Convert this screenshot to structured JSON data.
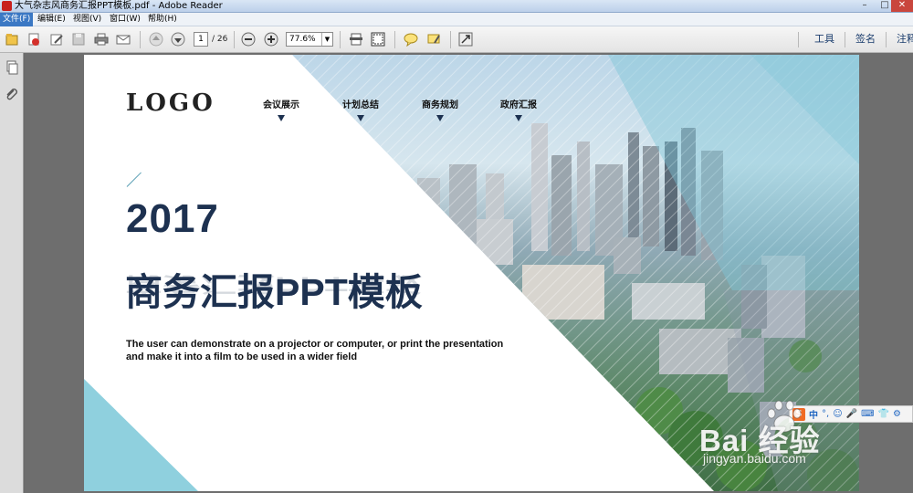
{
  "window": {
    "title": "大气杂志风商务汇报PPT模板.pdf - Adobe Reader",
    "min_label": "–",
    "max_label": "□",
    "close_label": "✕"
  },
  "menu": {
    "items": [
      {
        "label": "文件(F)",
        "active": true
      },
      {
        "label": "编辑(E)"
      },
      {
        "label": "视图(V)"
      },
      {
        "label": "窗口(W)"
      },
      {
        "label": "帮助(H)"
      }
    ]
  },
  "toolbar": {
    "page_current": "1",
    "page_total": "/ 26",
    "zoom": "77.6%",
    "right_links": [
      "工具",
      "签名",
      "注释"
    ]
  },
  "slide": {
    "logo": "LOGO",
    "nav": [
      "会议展示",
      "计划总结",
      "商务规划",
      "政府汇报"
    ],
    "year": "2017",
    "headline": "商务汇报PPT模板",
    "subtext_line1": "The user can demonstrate on a projector or computer, or print the presentation",
    "subtext_line2": "and make it into a film to be used in a wider field",
    "colors": {
      "navy": "#1d3150",
      "teal": "#7fc6d6",
      "accent": "#5ba0b5"
    }
  },
  "ime": {
    "logo": "S",
    "mode": "中",
    "glyphs": [
      "°,",
      "☺",
      "🎤",
      "⌨",
      "👕",
      "⚙"
    ]
  },
  "watermark": {
    "brand": "Bai  经验",
    "site": "jingyan.baidu.com"
  }
}
